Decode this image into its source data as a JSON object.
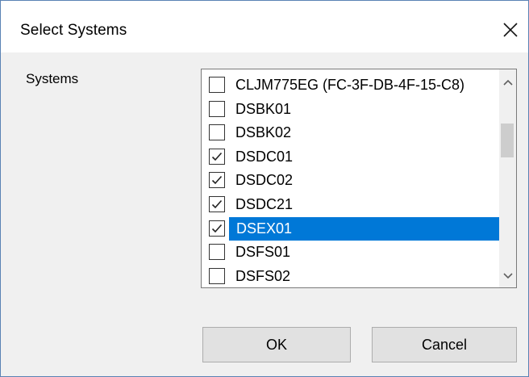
{
  "dialog": {
    "title": "Select Systems",
    "close_icon": "close-icon"
  },
  "form": {
    "systems_label": "Systems"
  },
  "systems_list": {
    "items": [
      {
        "label": "CLJM775EG (FC-3F-DB-4F-15-C8)",
        "checked": false,
        "selected": false
      },
      {
        "label": "DSBK01",
        "checked": false,
        "selected": false
      },
      {
        "label": "DSBK02",
        "checked": false,
        "selected": false
      },
      {
        "label": "DSDC01",
        "checked": true,
        "selected": false
      },
      {
        "label": "DSDC02",
        "checked": true,
        "selected": false
      },
      {
        "label": "DSDC21",
        "checked": true,
        "selected": false
      },
      {
        "label": "DSEX01",
        "checked": true,
        "selected": true
      },
      {
        "label": "DSFS01",
        "checked": false,
        "selected": false
      },
      {
        "label": "DSFS02",
        "checked": false,
        "selected": false
      }
    ],
    "selection_color": "#0078d7"
  },
  "buttons": {
    "ok_label": "OK",
    "cancel_label": "Cancel"
  }
}
